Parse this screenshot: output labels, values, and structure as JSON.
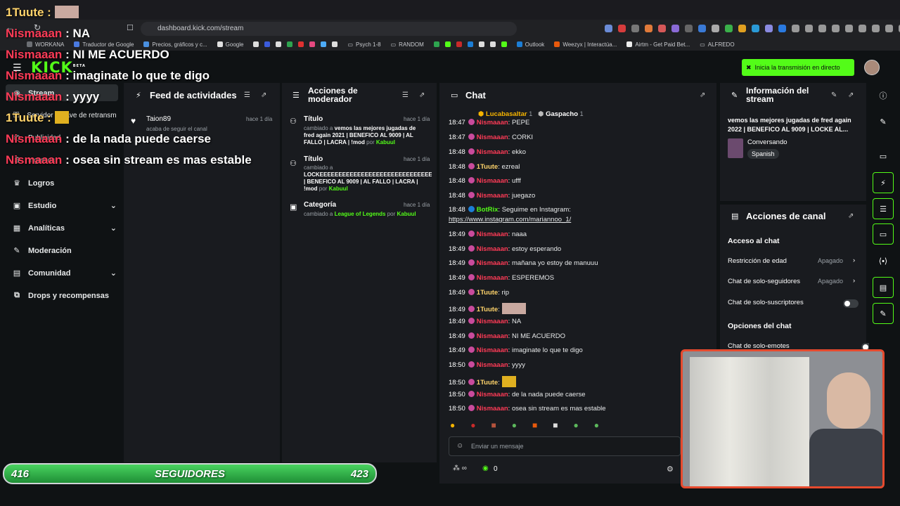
{
  "browser": {
    "url": "dashboard.kick.com/stream",
    "bookmarks": [
      "WORKANA",
      "Traductor de Google",
      "Precios, gráficos y c...",
      "Google",
      "Psych 1-8",
      "RANDOM",
      "Outlook",
      "Weezyx | Interactúa...",
      "Airtm - Get Paid Bet...",
      "ALFREDO"
    ]
  },
  "app": {
    "logo": "KICK",
    "logo_sup": "BETA",
    "golive_label": "Inicia la transmisión en directo"
  },
  "sidebar": {
    "items": [
      {
        "label": "Stream"
      },
      {
        "label": "Servidor y clave de retransmisión"
      },
      {
        "label": "Publicidad"
      },
      {
        "label": "Ingresos"
      },
      {
        "label": "Logros"
      },
      {
        "label": "Estudio"
      },
      {
        "label": "Analíticas"
      },
      {
        "label": "Moderación"
      },
      {
        "label": "Comunidad"
      },
      {
        "label": "Drops y recompensas"
      }
    ]
  },
  "feed": {
    "title": "Feed de actividades",
    "items": [
      {
        "user": "Taion89",
        "desc": "acaba de seguir el canal",
        "time": "hace 1 día"
      }
    ]
  },
  "modactions": {
    "title_line1": "Acciones de",
    "title_line2": "moderador",
    "items": [
      {
        "title": "Título",
        "time": "hace 1 día",
        "l1": "cambiado a",
        "b1": "vemos las mejores jugadas de",
        "b2": "fred again 2021 | BENEFICO AL 9009 | AL",
        "b3": "FALLO | LACRA | !mod",
        "by": "por",
        "user": "Kabuul"
      },
      {
        "title": "Título",
        "time": "hace 1 día",
        "l1": "cambiado a",
        "b1": "LOCKEEEEEEEEEEEEEEEEEEEEEEEEEEEEEEEEEE",
        "b2": "| BENEFICO AL 9009 | AL FALLO | LACRA |",
        "b3": "!mod",
        "by": "por",
        "user": "Kabuul"
      },
      {
        "title": "Categoría",
        "time": "hace 1 día",
        "l1": "cambiado a",
        "b1": "League of Legends",
        "by": "por",
        "user": "Kabuul"
      }
    ]
  },
  "chat": {
    "title": "Chat",
    "top_gifters": [
      {
        "name": "Lucabasaltar",
        "count": "1"
      },
      {
        "name": "Gaspacho",
        "count": "1"
      }
    ],
    "messages": [
      {
        "time": "18:47",
        "user": "Nismaaan",
        "text": "PEPE"
      },
      {
        "time": "18:47",
        "user": "Nismaaan",
        "text": "CORKI"
      },
      {
        "time": "18:48",
        "user": "Nismaaan",
        "text": "ekko"
      },
      {
        "time": "18:48",
        "user": "1Tuute",
        "text": "ezreal"
      },
      {
        "time": "18:48",
        "user": "Nismaaan",
        "text": "ufff"
      },
      {
        "time": "18:48",
        "user": "Nismaaan",
        "text": "juegazo"
      },
      {
        "time": "18:48",
        "user": "BotRix",
        "text": "Seguime en Instagram:",
        "text2": "https://www.instagram.com/mariannoo_1/"
      },
      {
        "time": "18:49",
        "user": "Nismaaan",
        "text": "naaa"
      },
      {
        "time": "18:49",
        "user": "Nismaaan",
        "text": "estoy esperando"
      },
      {
        "time": "18:49",
        "user": "Nismaaan",
        "text": "mañana yo estoy de manuuu"
      },
      {
        "time": "18:49",
        "user": "Nismaaan",
        "text": "ESPEREMOS"
      },
      {
        "time": "18:49",
        "user": "1Tuute",
        "text": "rip"
      },
      {
        "time": "18:49",
        "user": "1Tuute",
        "text": ""
      },
      {
        "time": "18:49",
        "user": "Nismaaan",
        "text": "NA"
      },
      {
        "time": "18:49",
        "user": "Nismaaan",
        "text": "NI ME ACUERDO"
      },
      {
        "time": "18:49",
        "user": "Nismaaan",
        "text": "imaginate lo que te digo"
      },
      {
        "time": "18:50",
        "user": "Nismaaan",
        "text": "yyyy"
      },
      {
        "time": "18:50",
        "user": "1Tuute",
        "text": ""
      },
      {
        "time": "18:50",
        "user": "Nismaaan",
        "text": "de la nada puede caerse"
      },
      {
        "time": "18:50",
        "user": "Nismaaan",
        "text": "osea sin stream es mas estable"
      }
    ],
    "input_placeholder": "Enviar un mensaje",
    "points": "0"
  },
  "streaminfo": {
    "title_line1": "Información del",
    "title_line2": "stream",
    "stream_title": "vemos las mejores jugadas de fred again 2022 | BENEFICO AL 9009 | LOCKE AL...",
    "category": "Conversando",
    "language": "Spanish"
  },
  "channelactions": {
    "title": "Acciones de canal",
    "section1": "Acceso al chat",
    "rows": [
      {
        "label": "Restricción de edad",
        "value": "Apagado"
      },
      {
        "label": "Chat de solo-seguidores",
        "value": "Apagado"
      },
      {
        "label": "Chat de solo-suscriptores",
        "value": ""
      }
    ],
    "section2": "Opciones del chat",
    "row_emotes": "Chat de solo-emotes"
  },
  "overlay": {
    "lines": [
      {
        "user": "1Tuute :",
        "text": ""
      },
      {
        "user": "Nismaaan",
        "text": ": NA"
      },
      {
        "user": "Nismaaan",
        "text": ": NI ME ACUERDO"
      },
      {
        "user": "Nismaaan",
        "text": ": imaginate lo que te digo"
      },
      {
        "user": "Nismaaan",
        "text": ": yyyy"
      },
      {
        "user": "1Tuute :",
        "text": ""
      },
      {
        "user": "Nismaaan",
        "text": ": de la nada puede caerse"
      },
      {
        "user": "Nismaaan",
        "text": ": osea sin stream es mas estable"
      }
    ],
    "followers_current": "416",
    "followers_label": "SEGUIDORES",
    "followers_goal": "423"
  },
  "colors": {
    "kick_green": "#53fc18",
    "nick_pink": "#ff3b57",
    "cam_border": "#e64a2e"
  }
}
